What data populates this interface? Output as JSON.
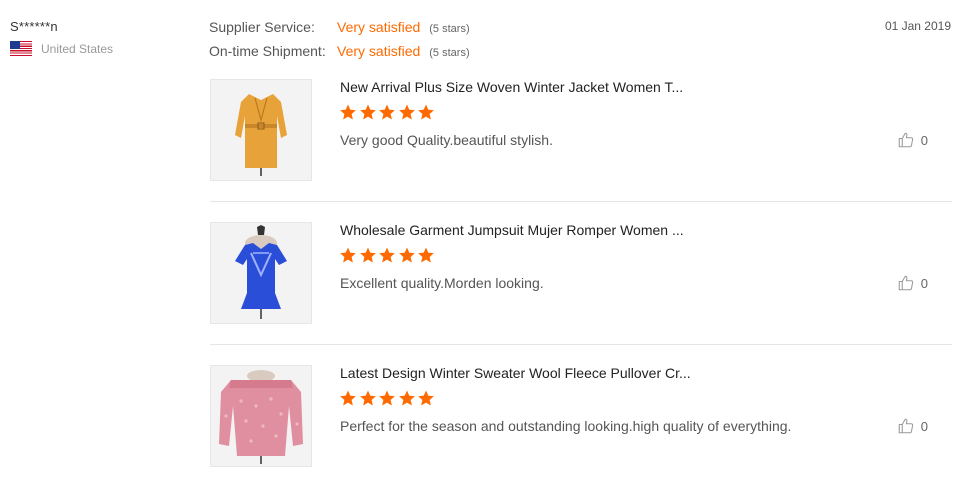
{
  "reviewer": {
    "name": "S******n",
    "country": "United States",
    "flag_icon": "us-flag-icon"
  },
  "ratings": [
    {
      "label": "Supplier Service:",
      "value": "Very satisfied",
      "stars": "(5 stars)"
    },
    {
      "label": "On-time Shipment:",
      "value": "Very satisfied",
      "stars": "(5 stars)"
    }
  ],
  "date": "01 Jan 2019",
  "colors": {
    "accent": "#ff6a00",
    "star": "#ff6a00"
  },
  "reviews": [
    {
      "product_title": "New Arrival Plus Size Woven Winter Jacket Women T...",
      "rating": 5,
      "text": "Very good Quality.beautiful stylish.",
      "likes": "0"
    },
    {
      "product_title": "Wholesale Garment Jumpsuit Mujer Romper Women ...",
      "rating": 5,
      "text": "Excellent quality.Morden looking.",
      "likes": "0"
    },
    {
      "product_title": "Latest Design Winter Sweater Wool Fleece Pullover Cr...",
      "rating": 5,
      "text": "Perfect for the season and outstanding looking.high quality of everything.",
      "likes": "0"
    }
  ]
}
